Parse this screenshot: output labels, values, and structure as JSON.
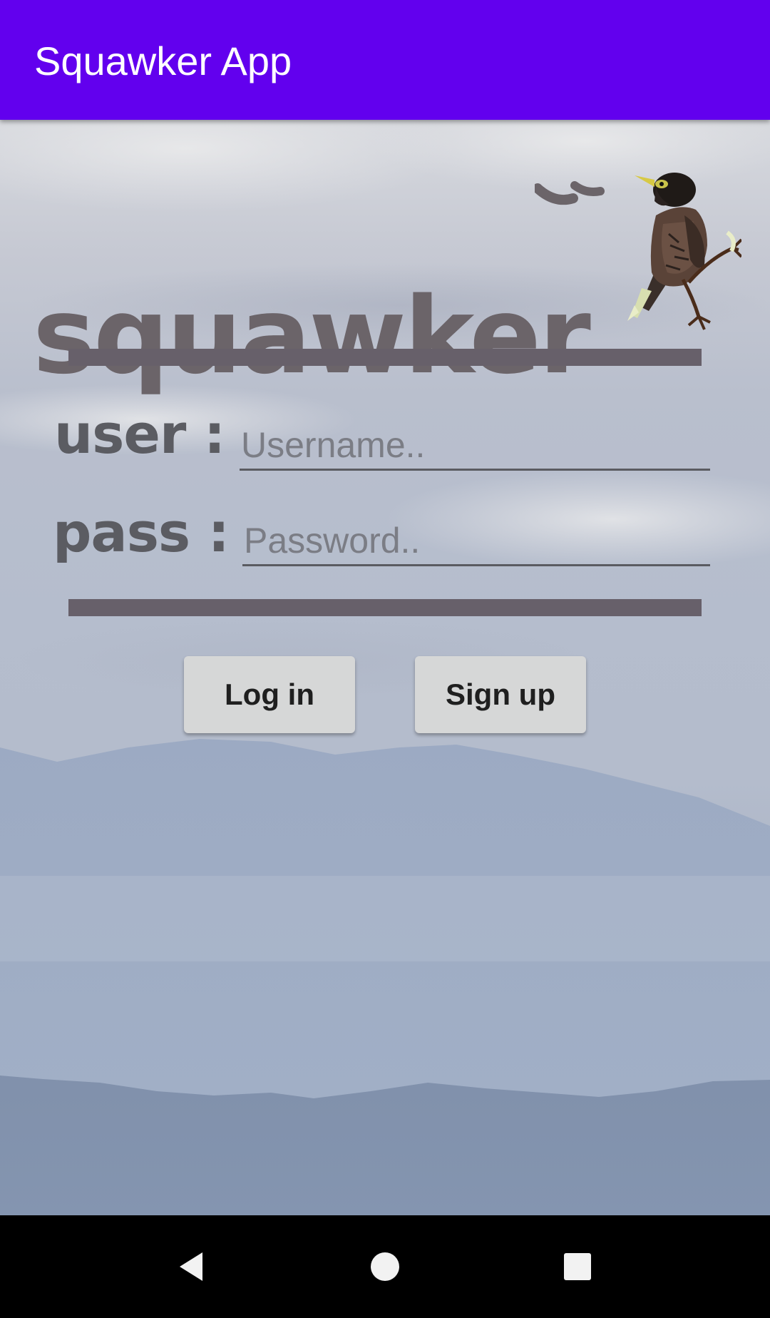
{
  "app_bar": {
    "title": "Squawker App",
    "color": "#6200ee"
  },
  "logo": {
    "text": "squawker",
    "bird_icon": "myna-bird-icon"
  },
  "form": {
    "user_label": "user :",
    "username_placeholder": "Username..",
    "username_value": "",
    "pass_label": "pass :",
    "password_placeholder": "Password..",
    "password_value": ""
  },
  "buttons": {
    "login_label": "Log in",
    "signup_label": "Sign up"
  },
  "nav_bar": {
    "back_icon": "back-triangle-icon",
    "home_icon": "home-circle-icon",
    "recents_icon": "recents-square-icon"
  },
  "colors": {
    "text_brown": "#6b6469",
    "divider": "#67606a",
    "button_bg": "#d6d7d7"
  }
}
